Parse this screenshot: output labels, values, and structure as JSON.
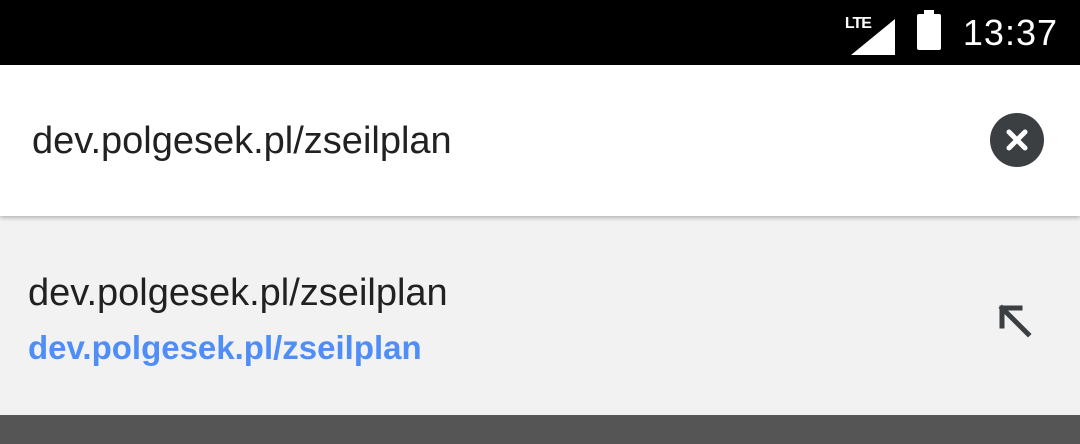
{
  "status_bar": {
    "network_label": "LTE",
    "time": "13:37",
    "icons": [
      "lte-signal-icon",
      "battery-icon"
    ]
  },
  "omnibox": {
    "value": "dev.polgesek.pl/zseilplan",
    "clear_icon": "close-circle-icon"
  },
  "suggestions": [
    {
      "title": "dev.polgesek.pl/zseilplan",
      "url": "dev.polgesek.pl/zseilplan",
      "action_icon": "arrow-up-left-icon"
    }
  ],
  "colors": {
    "status_bar_bg": "#000000",
    "omnibox_bg": "#ffffff",
    "suggestions_bg": "#f2f2f2",
    "url_link": "#4f8ef7",
    "clear_button": "#3c3f42",
    "backdrop": "#555555"
  }
}
